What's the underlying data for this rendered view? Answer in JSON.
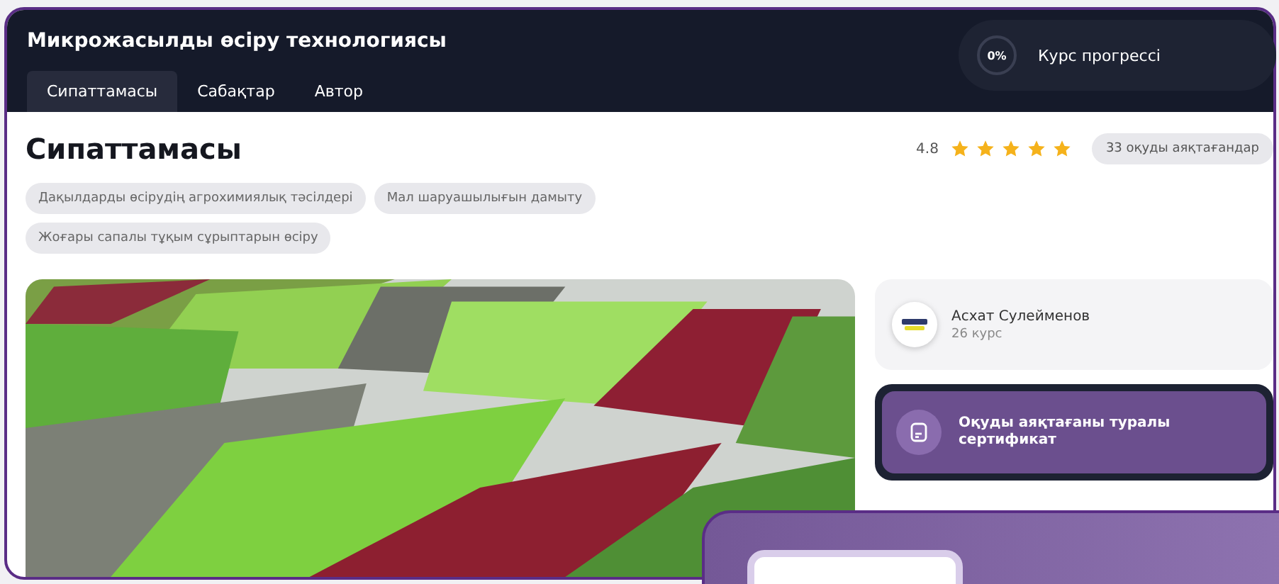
{
  "header": {
    "title": "Микрожасылды өсіру технологиясы",
    "tabs": [
      {
        "label": "Сипаттамасы",
        "selected": true
      },
      {
        "label": "Сабақтар",
        "selected": false
      },
      {
        "label": "Автор",
        "selected": false
      }
    ]
  },
  "progress": {
    "percent": "0%",
    "label": "Курс прогрессі",
    "level": 0
  },
  "section": {
    "title": "Сипаттамасы",
    "rating": "4.8",
    "stars": 5,
    "completed": "33 оқуды аяқтағандар",
    "tags": [
      "Дақылдарды өсірудің агрохимиялық тәсілдері",
      "Мал шаруашылығын дамыту",
      "Жоғары сапалы тұқым сұрыптарын өсіру"
    ]
  },
  "author": {
    "name": "Асхат Сулейменов",
    "courses": "26 курс"
  },
  "certificate": {
    "label": "Оқуды аяқтағаны туралы сертификат"
  }
}
